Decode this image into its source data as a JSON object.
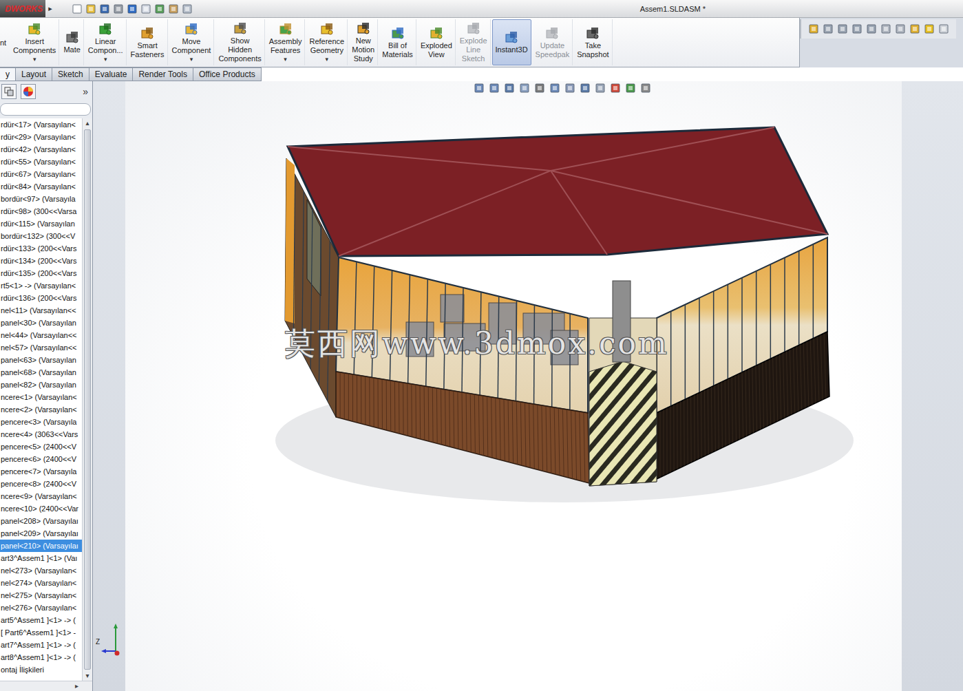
{
  "window": {
    "logo": "DWORKS",
    "flyout": "▸",
    "title": "Assem1.SLDASM *"
  },
  "command_manager": {
    "cut_label": "nt",
    "dropdown_glyph": "▾",
    "buttons": [
      {
        "label": "Insert\nComponents",
        "dropdown": true,
        "disabled": false,
        "selected": false
      },
      {
        "label": "Mate",
        "dropdown": false,
        "disabled": false,
        "selected": false
      },
      {
        "label": "Linear\nCompon...",
        "dropdown": true,
        "disabled": false,
        "selected": false
      },
      {
        "label": "Smart\nFasteners",
        "dropdown": false,
        "disabled": false,
        "selected": false
      },
      {
        "label": "Move\nComponent",
        "dropdown": true,
        "disabled": false,
        "selected": false
      },
      {
        "label": "Show\nHidden\nComponents",
        "dropdown": false,
        "disabled": false,
        "selected": false
      },
      {
        "label": "Assembly\nFeatures",
        "dropdown": true,
        "disabled": false,
        "selected": false
      },
      {
        "label": "Reference\nGeometry",
        "dropdown": true,
        "disabled": false,
        "selected": false
      },
      {
        "label": "New\nMotion\nStudy",
        "dropdown": false,
        "disabled": false,
        "selected": false
      },
      {
        "label": "Bill of\nMaterials",
        "dropdown": false,
        "disabled": false,
        "selected": false
      },
      {
        "label": "Exploded\nView",
        "dropdown": false,
        "disabled": false,
        "selected": false
      },
      {
        "label": "Explode\nLine\nSketch",
        "dropdown": false,
        "disabled": true,
        "selected": false
      },
      {
        "label": "Instant3D",
        "dropdown": false,
        "disabled": false,
        "selected": true
      },
      {
        "label": "Update\nSpeedpak",
        "dropdown": false,
        "disabled": true,
        "selected": false
      },
      {
        "label": "Take\nSnapshot",
        "dropdown": false,
        "disabled": false,
        "selected": false
      }
    ]
  },
  "tabs": [
    {
      "label": "y",
      "selected": true
    },
    {
      "label": "Layout",
      "selected": false
    },
    {
      "label": "Sketch",
      "selected": false
    },
    {
      "label": "Evaluate",
      "selected": false
    },
    {
      "label": "Render Tools",
      "selected": false
    },
    {
      "label": "Office Products",
      "selected": false
    }
  ],
  "feature_tree": {
    "expand_glyph": "»",
    "scroll_up": "▴",
    "scroll_down": "▾",
    "scroll_right": "▸",
    "items": [
      {
        "label": "rdür<17> (Varsayılan<",
        "selected": false
      },
      {
        "label": "rdür<29> (Varsayılan<",
        "selected": false
      },
      {
        "label": "rdür<42> (Varsayılan<",
        "selected": false
      },
      {
        "label": "rdür<55> (Varsayılan<",
        "selected": false
      },
      {
        "label": "rdür<67> (Varsayılan<",
        "selected": false
      },
      {
        "label": "rdür<84> (Varsayılan<",
        "selected": false
      },
      {
        "label": "bordür<97> (Varsayıla",
        "selected": false
      },
      {
        "label": "rdür<98> (300<<Varsa",
        "selected": false
      },
      {
        "label": "rdür<115> (Varsayılan",
        "selected": false
      },
      {
        "label": "bordür<132> (300<<V",
        "selected": false
      },
      {
        "label": "rdür<133> (200<<Vars",
        "selected": false
      },
      {
        "label": "rdür<134> (200<<Vars",
        "selected": false
      },
      {
        "label": "rdür<135> (200<<Vars",
        "selected": false
      },
      {
        "label": "rt5<1> -> (Varsayılan<",
        "selected": false
      },
      {
        "label": "rdür<136> (200<<Vars",
        "selected": false
      },
      {
        "label": "nel<11> (Varsayılan<<",
        "selected": false
      },
      {
        "label": "panel<30> (Varsayılan",
        "selected": false
      },
      {
        "label": "nel<44> (Varsayılan<<",
        "selected": false
      },
      {
        "label": "nel<57> (Varsayılan<<",
        "selected": false
      },
      {
        "label": "panel<63> (Varsayılan",
        "selected": false
      },
      {
        "label": "panel<68> (Varsayılan",
        "selected": false
      },
      {
        "label": "panel<82> (Varsayılan",
        "selected": false
      },
      {
        "label": "ncere<1> (Varsayılan<",
        "selected": false
      },
      {
        "label": "ncere<2> (Varsayılan<",
        "selected": false
      },
      {
        "label": "pencere<3> (Varsayıla",
        "selected": false
      },
      {
        "label": "ncere<4> (3063<<Vars",
        "selected": false
      },
      {
        "label": "pencere<5> (2400<<V",
        "selected": false
      },
      {
        "label": "pencere<6> (2400<<V",
        "selected": false
      },
      {
        "label": "pencere<7> (Varsayıla",
        "selected": false
      },
      {
        "label": "pencere<8> (2400<<V",
        "selected": false
      },
      {
        "label": "ncere<9> (Varsayılan<",
        "selected": false
      },
      {
        "label": "ncere<10> (2400<<Var",
        "selected": false
      },
      {
        "label": "panel<208> (Varsayılaı",
        "selected": false
      },
      {
        "label": "panel<209> (Varsayılaı",
        "selected": false
      },
      {
        "label": "panel<210> (Varsayılaı",
        "selected": true
      },
      {
        "label": "art3^Assem1 ]<1> (Vaı",
        "selected": false
      },
      {
        "label": "nel<273> (Varsayılan<",
        "selected": false
      },
      {
        "label": "nel<274> (Varsayılan<",
        "selected": false
      },
      {
        "label": "nel<275> (Varsayılan<",
        "selected": false
      },
      {
        "label": "nel<276> (Varsayılan<",
        "selected": false
      },
      {
        "label": "art5^Assem1 ]<1> -> (",
        "selected": false
      },
      {
        "label": "[ Part6^Assem1 ]<1> -",
        "selected": false
      },
      {
        "label": "art7^Assem1 ]<1> -> (",
        "selected": false
      },
      {
        "label": "art8^Assem1 ]<1> -> (",
        "selected": false
      },
      {
        "label": "ontaj İlişkileri",
        "selected": false
      }
    ]
  },
  "viewport": {
    "watermark": "莫西网www.3dmox.com",
    "axis_label": "Z"
  }
}
